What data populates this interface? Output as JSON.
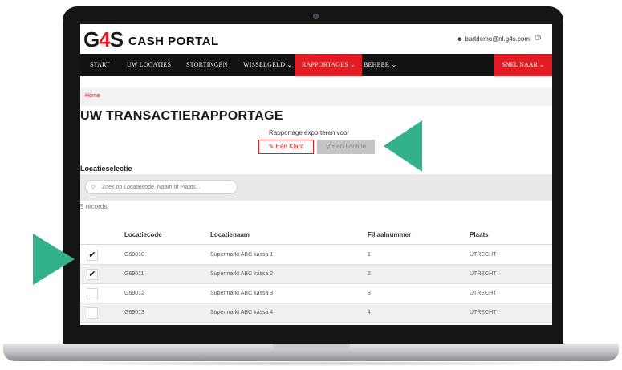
{
  "brand": {
    "logo_text_a": "G",
    "logo_text_4": "4",
    "logo_text_s": "S",
    "portal_title": "CASH PORTAL",
    "accent_color": "#e31b23",
    "arrow_color": "#33b08c"
  },
  "user": {
    "email": "bartdemo@nl.g4s.com",
    "user_icon": "person-icon",
    "power_icon": "power-icon"
  },
  "nav": {
    "items": [
      {
        "label": "START"
      },
      {
        "label": "UW LOCATIES"
      },
      {
        "label": "STORTINGEN"
      },
      {
        "label": "WISSELGELD ⌄"
      },
      {
        "label": "RAPPORTAGES ⌄"
      },
      {
        "label": "BEHEER ⌄"
      }
    ],
    "active_index": 4,
    "snel_naar": "SNEL NAAR ⌄"
  },
  "breadcrumb": {
    "home": "Home"
  },
  "page": {
    "title": "UW TRANSACTIERAPPORTAGE"
  },
  "export": {
    "label": "Rapportage exporteren voor",
    "klant_button": "Een Klant",
    "locatie_button": "Een Locatie"
  },
  "location_selection": {
    "label": "Locatieselectie",
    "search_placeholder": "Zoek op Locatiecode, Naam of Plaats..."
  },
  "records": "5 records",
  "table": {
    "headers": [
      "Locatiecode",
      "Locatienaam",
      "Filiaalnummer",
      "Plaats"
    ],
    "rows": [
      {
        "checked": true,
        "code": "G69010",
        "name": "Supermarkt ABC kassa 1",
        "nr": "1",
        "city": "UTRECHT"
      },
      {
        "checked": true,
        "code": "G69011",
        "name": "Supermarkt ABC kassa 2",
        "nr": "2",
        "city": "UTRECHT"
      },
      {
        "checked": false,
        "code": "G69012",
        "name": "Supermarkt ABC kassa 3",
        "nr": "3",
        "city": "UTRECHT"
      },
      {
        "checked": false,
        "code": "G69013",
        "name": "Supermarkt ABC kassa 4",
        "nr": "4",
        "city": "UTRECHT"
      }
    ]
  }
}
